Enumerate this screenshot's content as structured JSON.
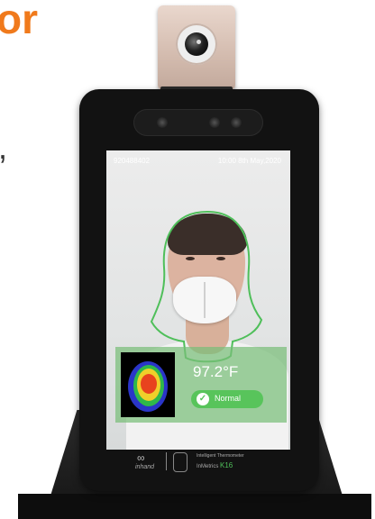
{
  "headline": "or",
  "headline_punct": ",",
  "screen": {
    "device_id": "920488402",
    "datetime": "10:00 8th May,2020"
  },
  "result": {
    "temperature": "97.2°F",
    "status": "Normal"
  },
  "brand": {
    "logo_text": "inhand",
    "product_name": "Intelligent Thermometer",
    "product_series": "InMetrics",
    "model": "K16"
  },
  "colors": {
    "headline": "#f07a1c",
    "status_green": "#58c45b",
    "face_outline": "#4fbf5a"
  }
}
